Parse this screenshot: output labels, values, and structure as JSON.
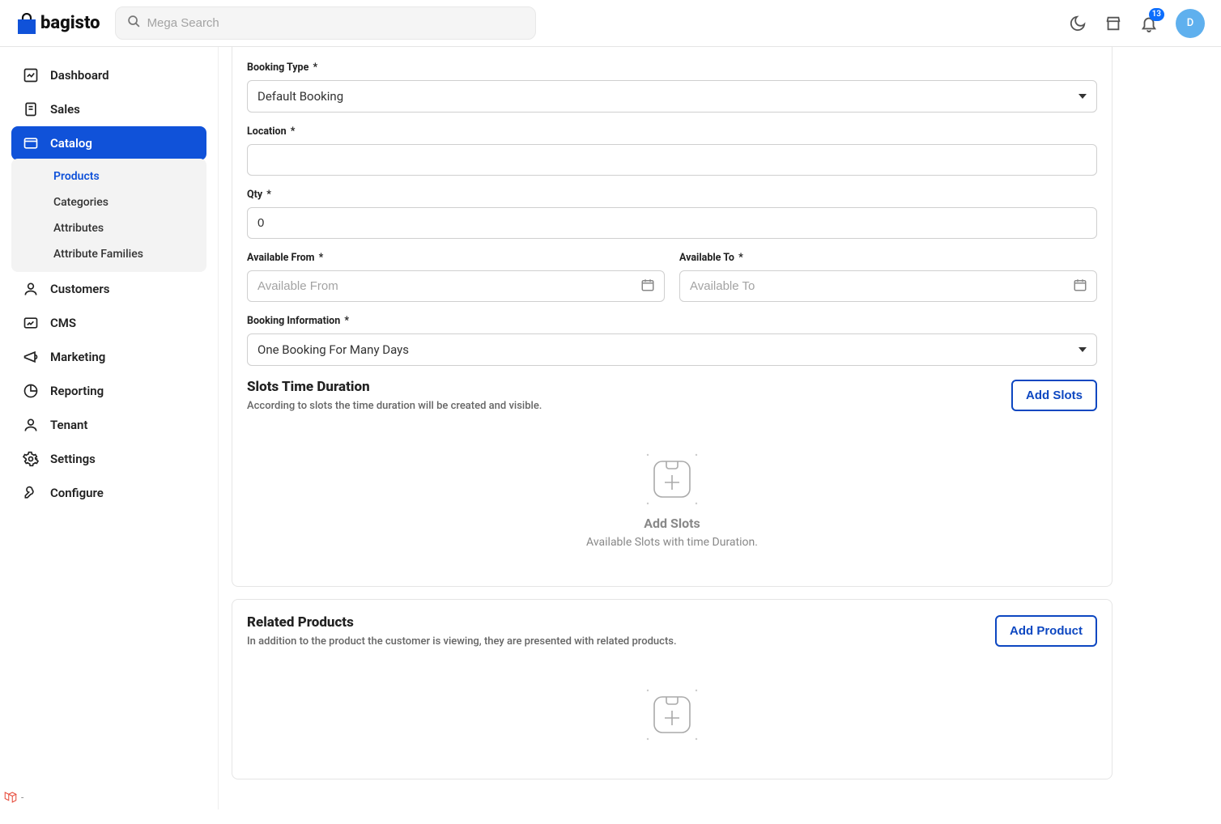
{
  "brand": "bagisto",
  "search": {
    "placeholder": "Mega Search"
  },
  "header": {
    "notif_count": "13",
    "avatar": "D"
  },
  "sidebar": {
    "items": [
      {
        "label": "Dashboard"
      },
      {
        "label": "Sales"
      },
      {
        "label": "Catalog"
      },
      {
        "label": "Customers"
      },
      {
        "label": "CMS"
      },
      {
        "label": "Marketing"
      },
      {
        "label": "Reporting"
      },
      {
        "label": "Tenant"
      },
      {
        "label": "Settings"
      },
      {
        "label": "Configure"
      }
    ],
    "catalog_sub": [
      {
        "label": "Products"
      },
      {
        "label": "Categories"
      },
      {
        "label": "Attributes"
      },
      {
        "label": "Attribute Families"
      }
    ]
  },
  "form": {
    "booking_type": {
      "label": "Booking Type",
      "value": "Default Booking"
    },
    "location": {
      "label": "Location",
      "value": ""
    },
    "qty": {
      "label": "Qty",
      "value": "0"
    },
    "avail_from": {
      "label": "Available From",
      "placeholder": "Available From",
      "value": ""
    },
    "avail_to": {
      "label": "Available To",
      "placeholder": "Available To",
      "value": ""
    },
    "booking_info": {
      "label": "Booking Information",
      "value": "One Booking For Many Days"
    }
  },
  "slots": {
    "title": "Slots Time Duration",
    "sub": "According to slots the time duration will be created and visible.",
    "btn": "Add Slots",
    "empty_title": "Add Slots",
    "empty_sub": "Available Slots with time Duration."
  },
  "related": {
    "title": "Related Products",
    "sub": "In addition to the product the customer is viewing, they are presented with related products.",
    "btn": "Add Product"
  }
}
